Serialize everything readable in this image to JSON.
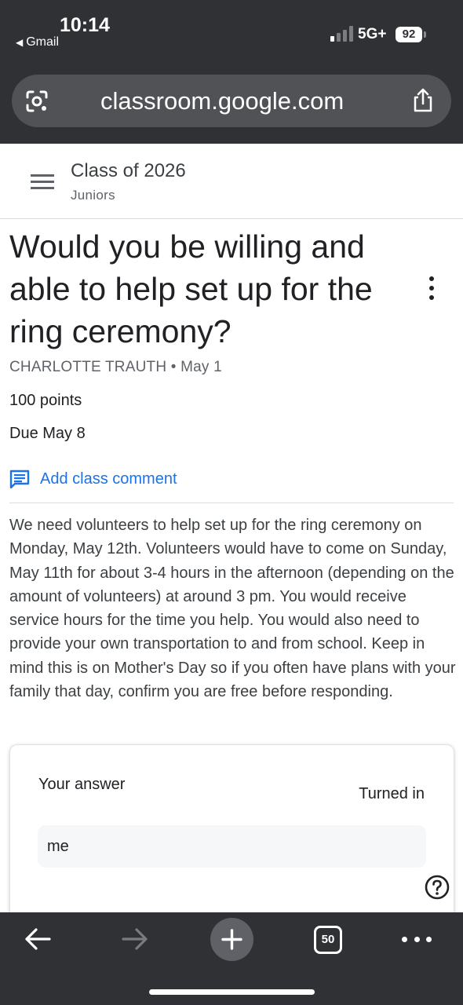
{
  "status_bar": {
    "time": "10:14",
    "back_app": "Gmail",
    "network": "5G+",
    "battery": "92"
  },
  "browser": {
    "url": "classroom.google.com",
    "tab_count": "50",
    "icons": {
      "lens": "lens-icon",
      "share": "share-icon",
      "back": "arrow-left-icon",
      "forward": "arrow-right-icon",
      "new_tab": "plus-icon",
      "more": "more-horiz-icon"
    }
  },
  "header": {
    "class_name": "Class of 2026",
    "section": "Juniors"
  },
  "assignment": {
    "title": "Would you be willing and able to help set up for the ring ceremony?",
    "author": "CHARLOTTE TRAUTH",
    "separator": "•",
    "posted_date": "May 1",
    "points": "100 points",
    "due": "Due May 8",
    "add_comment_label": "Add class comment",
    "description": "We need volunteers to help set up for the ring ceremony on Monday, May 12th. Volunteers would have to come on Sunday, May 11th for about 3-4 hours in the afternoon (depending on the amount of volunteers) at around 3 pm. You would receive service hours for the time you help. You would also need to provide your own transportation to and from school. Keep in mind this is on Mother's Day so if you often have plans with your family that day, confirm you are free before responding."
  },
  "answer": {
    "label": "Your answer",
    "status": "Turned in",
    "value": "me"
  },
  "colors": {
    "chrome_bg": "#303134",
    "link_blue": "#1a73e8"
  }
}
